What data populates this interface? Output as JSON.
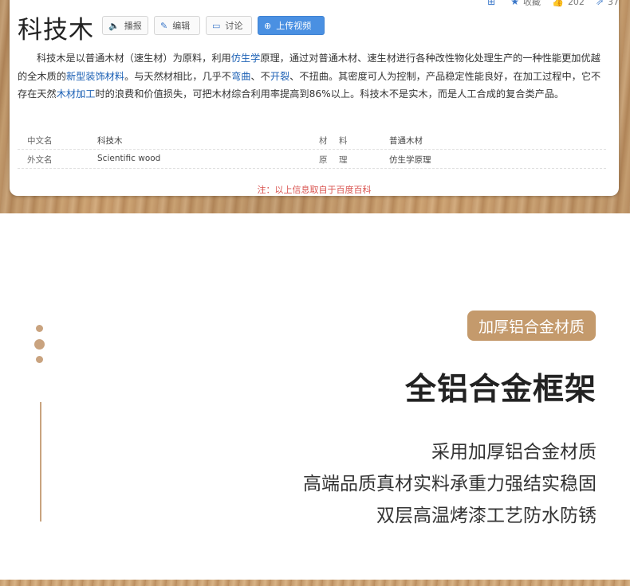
{
  "card": {
    "title": "科技木",
    "buttons": [
      {
        "icon": "speaker-icon",
        "glyph": "🔈",
        "label": "播报"
      },
      {
        "icon": "pencil-icon",
        "glyph": "✎",
        "label": "编辑"
      },
      {
        "icon": "comment-icon",
        "glyph": "▭",
        "label": "讨论"
      },
      {
        "icon": "plus-circle-icon",
        "glyph": "⊕",
        "label": "上传视频"
      }
    ],
    "stats": {
      "favorite_label": "收藏",
      "like_count": "202",
      "share_count": "37"
    },
    "paragraph": {
      "p1": "科技木是以普通木材（速生材）为原料，利用",
      "link1": "仿生学",
      "p2": "原理，通过对普通木材、速生材进行各种改性物化处理生产的一种性能更加优越的全木质的",
      "link2": "新型装饰材料",
      "p3": "。与天然材相比，几乎不",
      "link3": "弯曲",
      "p4": "、不",
      "link4": "开裂",
      "p5": "、不扭曲。其密度可人为控制，产品稳定性能良好，在加工过程中，它不存在天然",
      "link5": "木材加工",
      "p6": "时的浪费和价值损失，可把木材综合利用率提高到86%以上。科技木不是实木，而是人工合成的复合类产品。"
    },
    "info_rows": [
      {
        "k1": "中文名",
        "v1": "科技木",
        "k2": "材　料",
        "v2": "普通木材"
      },
      {
        "k1": "外文名",
        "v1": "Scientific wood",
        "k2": "原　理",
        "v2": "仿生学原理"
      }
    ],
    "note": "注：以上信息取自于百度百科"
  },
  "feature": {
    "badge": "加厚铝合金材质",
    "headline": "全铝合金框架",
    "lines": [
      "采用加厚铝合金材质",
      "高端品质真材实料承重力强结实稳固",
      "双层高温烤漆工艺防水防锈"
    ]
  },
  "colors": {
    "accent": "#c49a6c",
    "link": "#1a5fb4",
    "note": "#d9534f",
    "primary_button": "#4a90e2"
  }
}
